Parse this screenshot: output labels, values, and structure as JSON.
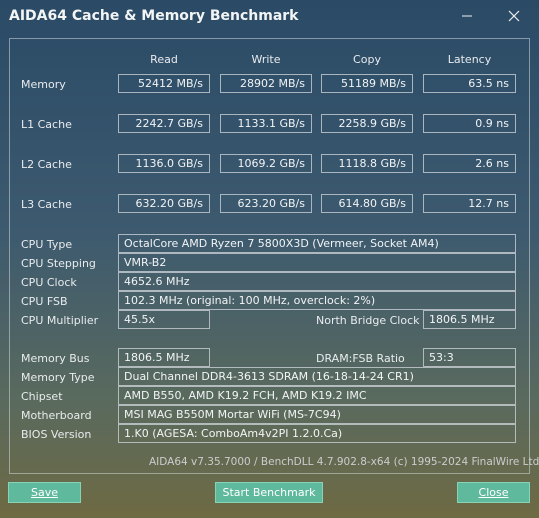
{
  "window": {
    "title": "AIDA64 Cache & Memory Benchmark"
  },
  "columns": {
    "read": "Read",
    "write": "Write",
    "copy": "Copy",
    "latency": "Latency"
  },
  "rows": [
    {
      "label": "Memory",
      "read": "52412 MB/s",
      "write": "28902 MB/s",
      "copy": "51189 MB/s",
      "latency": "63.5 ns"
    },
    {
      "label": "L1 Cache",
      "read": "2242.7 GB/s",
      "write": "1133.1 GB/s",
      "copy": "2258.9 GB/s",
      "latency": "0.9 ns"
    },
    {
      "label": "L2 Cache",
      "read": "1136.0 GB/s",
      "write": "1069.2 GB/s",
      "copy": "1118.8 GB/s",
      "latency": "2.6 ns"
    },
    {
      "label": "L3 Cache",
      "read": "632.20 GB/s",
      "write": "623.20 GB/s",
      "copy": "614.80 GB/s",
      "latency": "12.7 ns"
    }
  ],
  "cpu": {
    "type_label": "CPU Type",
    "type": "OctalCore AMD Ryzen 7 5800X3D  (Vermeer, Socket AM4)",
    "stepping_label": "CPU Stepping",
    "stepping": "VMR-B2",
    "clock_label": "CPU Clock",
    "clock": "4652.6 MHz",
    "fsb_label": "CPU FSB",
    "fsb": "102.3 MHz  (original: 100 MHz, overclock: 2%)",
    "multiplier_label": "CPU Multiplier",
    "multiplier": "45.5x",
    "nb_clock_label": "North Bridge Clock",
    "nb_clock": "1806.5 MHz"
  },
  "memory": {
    "bus_label": "Memory Bus",
    "bus": "1806.5 MHz",
    "ratio_label": "DRAM:FSB Ratio",
    "ratio": "53:3",
    "type_label": "Memory Type",
    "type": "Dual Channel DDR4-3613 SDRAM  (16-18-14-24 CR1)",
    "chipset_label": "Chipset",
    "chipset": "AMD B550, AMD K19.2 FCH, AMD K19.2 IMC",
    "motherboard_label": "Motherboard",
    "motherboard": "MSI MAG B550M Mortar WiFi (MS-7C94)",
    "bios_label": "BIOS Version",
    "bios": "1.K0  (AGESA: ComboAm4v2PI 1.2.0.Ca)"
  },
  "footer": "AIDA64 v7.35.7000 / BenchDLL 4.7.902.8-x64  (c) 1995-2024 FinalWire Ltd.",
  "buttons": {
    "save": "Save",
    "start": "Start Benchmark",
    "close": "Close"
  },
  "icons": {
    "minimize": "minimize-icon",
    "close": "close-icon"
  }
}
